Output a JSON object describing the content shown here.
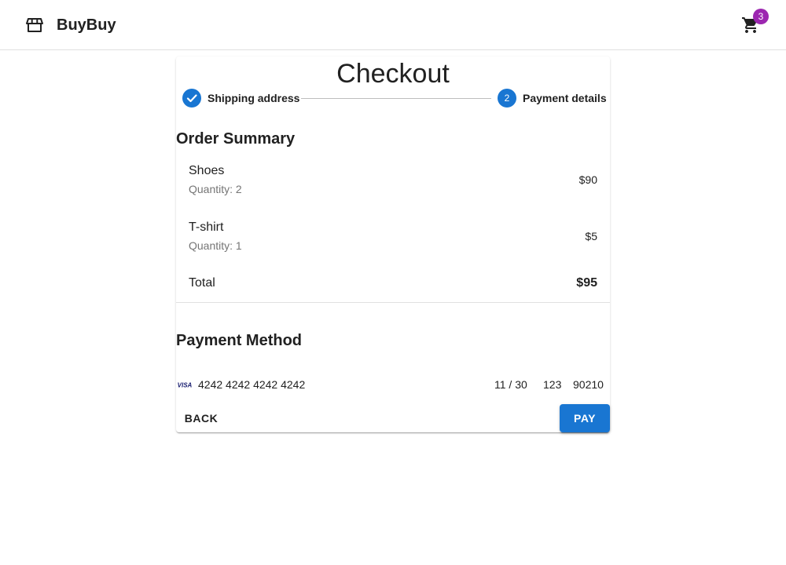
{
  "header": {
    "brand": "BuyBuy",
    "cart_count": "3",
    "store_icon": "storefront-icon",
    "cart_icon": "shopping-cart-icon"
  },
  "checkout": {
    "title": "Checkout",
    "steps": [
      {
        "label": "Shipping address",
        "state": "completed",
        "icon": "check-icon"
      },
      {
        "label": "Payment details",
        "number": "2",
        "state": "active"
      }
    ]
  },
  "order_summary": {
    "title": "Order Summary",
    "items": [
      {
        "name": "Shoes",
        "quantity": "Quantity: 2",
        "price": "$90"
      },
      {
        "name": "T-shirt",
        "quantity": "Quantity: 1",
        "price": "$5"
      }
    ],
    "total_label": "Total",
    "total_value": "$95"
  },
  "payment_method": {
    "title": "Payment Method",
    "card_brand": "VISA",
    "card_number": "4242 4242 4242 4242",
    "expiry": "11 / 30",
    "cvc": "123",
    "zip": "90210"
  },
  "actions": {
    "back_label": "BACK",
    "pay_label": "PAY"
  },
  "colors": {
    "primary": "#1976d2",
    "badge": "#9c27b0",
    "visa": "#1a1f71"
  }
}
